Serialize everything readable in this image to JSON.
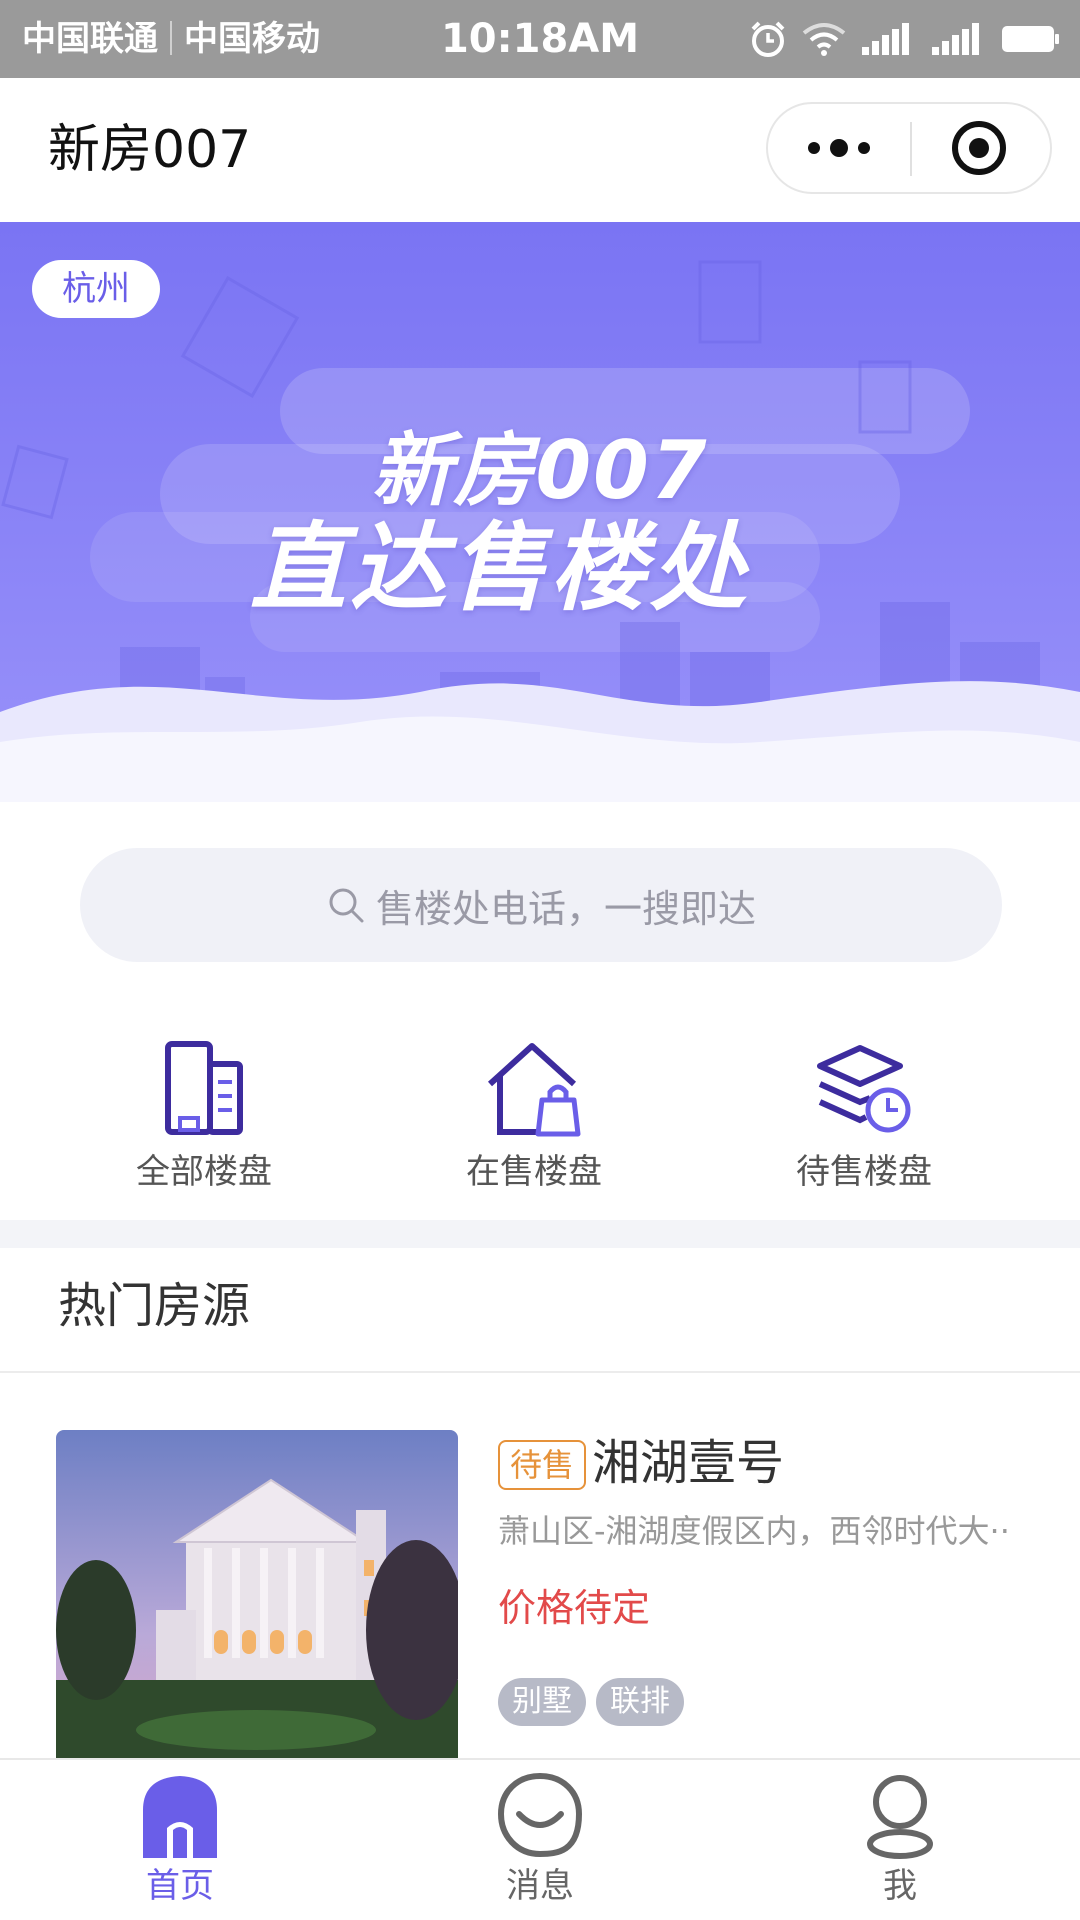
{
  "status_bar": {
    "carrier_1": "中国联通",
    "carrier_2": "中国移动",
    "time": "10:18AM",
    "icons": [
      "alarm-icon",
      "wifi-icon",
      "signal-2-icon",
      "signal-1-icon",
      "battery-icon"
    ]
  },
  "nav": {
    "title": "新房007",
    "more_icon": "more-dots-icon",
    "close_icon": "target-close-icon"
  },
  "banner": {
    "city": "杭州",
    "headline_1": "新房007",
    "headline_2": "直达售楼处",
    "colors": {
      "gradient_top": "#7d77f4",
      "gradient_bottom": "#9b91fa"
    }
  },
  "search": {
    "placeholder": "售楼处电话，一搜即达",
    "icon": "search-icon"
  },
  "categories": [
    {
      "label": "全部楼盘",
      "icon": "buildings-icon"
    },
    {
      "label": "在售楼盘",
      "icon": "house-bag-icon"
    },
    {
      "label": "待售楼盘",
      "icon": "layers-clock-icon"
    }
  ],
  "section": {
    "title": "热门房源"
  },
  "listings": [
    {
      "status": "待售",
      "name": "湘湖壹号",
      "address": "萧山区-湘湖度假区内，西邻时代大··",
      "price": "价格待定",
      "tags": [
        "别墅",
        "联排"
      ]
    }
  ],
  "tabbar": {
    "active_color": "#6a5ee8",
    "inactive_color": "#666666",
    "items": [
      {
        "label": "首页",
        "icon": "home-icon",
        "active": true
      },
      {
        "label": "消息",
        "icon": "message-icon",
        "active": false
      },
      {
        "label": "我",
        "icon": "profile-icon",
        "active": false
      }
    ]
  }
}
